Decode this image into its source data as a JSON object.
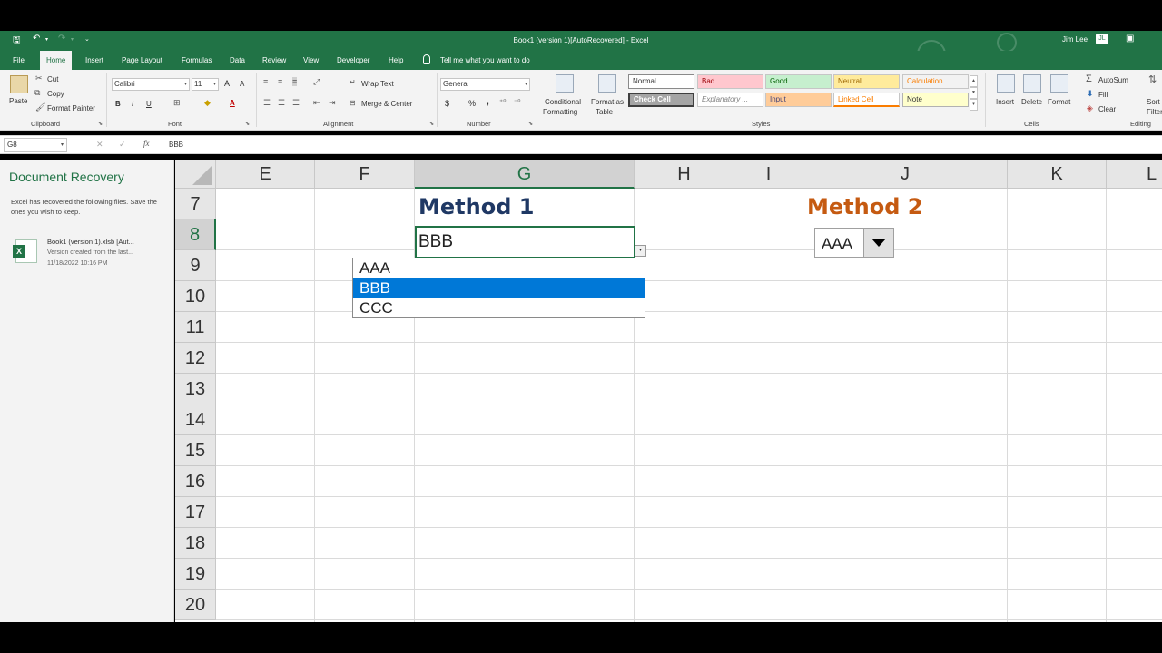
{
  "titlebar": {
    "title": "Book1 (version 1)[AutoRecovered]  -  Excel",
    "user": "Jim Lee",
    "user_badge": "JL"
  },
  "tabs": [
    "File",
    "Home",
    "Insert",
    "Page Layout",
    "Formulas",
    "Data",
    "Review",
    "View",
    "Developer",
    "Help"
  ],
  "tell_me": "Tell me what you want to do",
  "ribbon": {
    "clipboard": {
      "paste": "Paste",
      "cut": "Cut",
      "copy": "Copy",
      "format_painter": "Format Painter",
      "label": "Clipboard"
    },
    "font": {
      "name": "Calibri",
      "size": "11",
      "bold": "B",
      "italic": "I",
      "underline": "U",
      "grow": "A",
      "shrink": "A",
      "font_color": "A",
      "label": "Font"
    },
    "alignment": {
      "wrap_text": "Wrap Text",
      "merge_center": "Merge & Center",
      "label": "Alignment"
    },
    "number": {
      "format": "General",
      "currency": "$",
      "percent": "%",
      "comma": ",",
      "label": "Number"
    },
    "styles": {
      "conditional": [
        "Conditional",
        "Formatting"
      ],
      "format_table": [
        "Format as",
        "Table"
      ],
      "cells": [
        {
          "text": "Normal",
          "bg": "#ffffff",
          "fg": "#333333"
        },
        {
          "text": "Bad",
          "bg": "#ffc7ce",
          "fg": "#9c0006"
        },
        {
          "text": "Good",
          "bg": "#c6efce",
          "fg": "#006100"
        },
        {
          "text": "Neutral",
          "bg": "#ffeb9c",
          "fg": "#9c6500"
        },
        {
          "text": "Calculation",
          "bg": "#f2f2f2",
          "fg": "#fa7d00"
        },
        {
          "text": "Check Cell",
          "bg": "#a5a5a5",
          "fg": "#ffffff"
        },
        {
          "text": "Explanatory ...",
          "bg": "#ffffff",
          "fg": "#7f7f7f"
        },
        {
          "text": "Input",
          "bg": "#ffcc99",
          "fg": "#3f3f76"
        },
        {
          "text": "Linked Cell",
          "bg": "#ffffff",
          "fg": "#fa7d00"
        },
        {
          "text": "Note",
          "bg": "#ffffcc",
          "fg": "#333333"
        }
      ],
      "label": "Styles"
    },
    "cells": {
      "insert": "Insert",
      "delete": "Delete",
      "format": "Format",
      "label": "Cells"
    },
    "editing": {
      "autosum": "AutoSum",
      "fill": "Fill",
      "clear": "Clear",
      "sort": "Sort &",
      "filter": "Filter",
      "label": "Editing"
    }
  },
  "formula_bar": {
    "name_box": "G8",
    "cancel": "✕",
    "enter": "✓",
    "fx": "fx",
    "content": "BBB"
  },
  "recovery": {
    "title": "Document Recovery",
    "message": "Excel has recovered the following files.  Save the ones you wish to keep.",
    "file_name": "Book1 (version 1).xlsb  [Aut...",
    "file_version": "Version created from the last...",
    "file_time": "11/18/2022 10:16 PM"
  },
  "grid": {
    "columns": [
      "E",
      "F",
      "G",
      "H",
      "I",
      "J",
      "K",
      "L"
    ],
    "rows": [
      "7",
      "8",
      "9",
      "10",
      "11",
      "12",
      "13",
      "14",
      "15",
      "16",
      "17",
      "18",
      "19",
      "20"
    ],
    "selected_column": "G",
    "selected_row": "8"
  },
  "method1": "Method 1",
  "method2": "Method 2",
  "active_cell_value": "BBB",
  "dropdown_options": [
    "AAA",
    "BBB",
    "CCC"
  ],
  "dropdown_selected": "BBB",
  "combo_value": "AAA",
  "colors": {
    "excel_green": "#217346",
    "method1": "#1f3864",
    "method2": "#c55a11",
    "selection_blue": "#0078d7"
  }
}
